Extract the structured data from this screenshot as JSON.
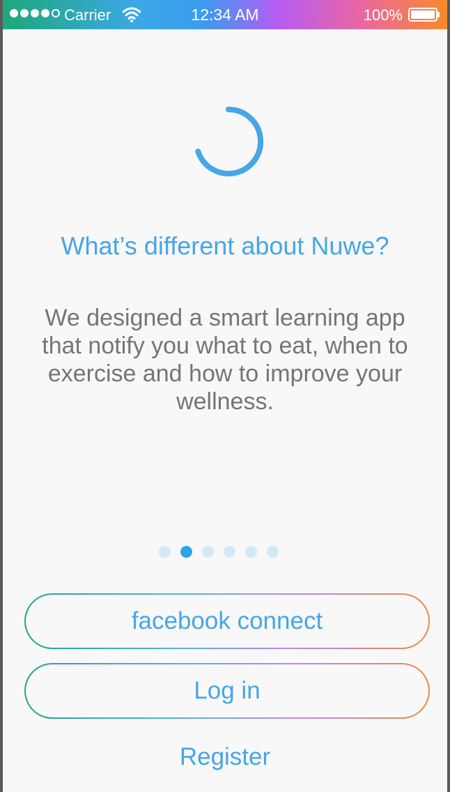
{
  "status_bar": {
    "carrier": "Carrier",
    "time": "12:34 AM",
    "battery": "100%",
    "signal_bars_filled": 4,
    "signal_bars_total": 5
  },
  "onboarding": {
    "title": "What’s different about Nuwe?",
    "description": "We designed a smart learning app that notify you what to eat, when to exercise and how to improve your wellness.",
    "page_count": 6,
    "active_page": 2
  },
  "actions": {
    "facebook_label": "facebook connect",
    "login_label": "Log in",
    "register_label": "Register"
  },
  "colors": {
    "accent": "#45a6e8",
    "body_text": "#757575",
    "active_dot": "#2aa5e6",
    "inactive_dot": "#d3e9f6"
  },
  "icons": {
    "loader": "progress-ring-icon",
    "wifi": "wifi-icon",
    "battery": "battery-icon"
  }
}
